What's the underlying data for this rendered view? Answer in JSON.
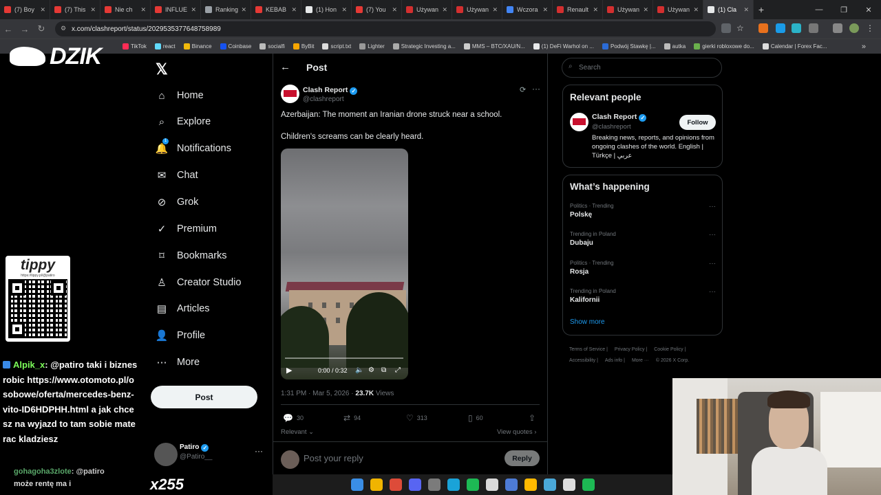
{
  "browser": {
    "tabs": [
      {
        "title": "(7) Boy",
        "color": "#e53935"
      },
      {
        "title": "(7) This",
        "color": "#e53935"
      },
      {
        "title": "Nie ch",
        "color": "#e53935"
      },
      {
        "title": "INFLUE",
        "color": "#e53935"
      },
      {
        "title": "Ranking",
        "color": "#9aa0a6"
      },
      {
        "title": "KEBAB",
        "color": "#e53935"
      },
      {
        "title": "(1) Hon",
        "color": "#e7e9ea"
      },
      {
        "title": "(7) You",
        "color": "#e53935"
      },
      {
        "title": "Używan",
        "color": "#d32f2f"
      },
      {
        "title": "Używan",
        "color": "#d32f2f"
      },
      {
        "title": "Wczora",
        "color": "#4285f4"
      },
      {
        "title": "Renault",
        "color": "#d32f2f"
      },
      {
        "title": "Używan",
        "color": "#d32f2f"
      },
      {
        "title": "Używan",
        "color": "#d32f2f"
      },
      {
        "title": "(1) Cla",
        "color": "#e7e9ea",
        "active": true
      }
    ],
    "url": "x.com/clashreport/status/2029535377648758989",
    "bookmarks": [
      "TikTok",
      "react",
      "Binance",
      "Coinbase",
      "socialfi",
      "ByBit",
      "script.txt",
      "Lighter",
      "Strategic Investing a...",
      "MMS – BTC/XAU/N...",
      "(1) DeFi Warhol on ...",
      "Podwój Stawkę |...",
      "autka",
      "gierki robloxowe do...",
      "Calendar | Forex Fac..."
    ]
  },
  "overlay": {
    "logo": "DZIK",
    "tippy_logo": "tippy",
    "tippy_url": "https://tippy.pl/@patiro",
    "chat": [
      {
        "nick": "Alpik_x",
        "text": ": @patiro taki i biznes robic https://www.otomoto.pl/osobowe/oferta/mercedes-benz-vito-ID6HDPHH.html a jak chcesz na wyjazd to tam sobie materac kladziesz"
      }
    ],
    "chat_next": {
      "nick": "gohagoha3zlote",
      "text": ": @patiro"
    },
    "chat_next2": "może rentę ma i",
    "counter": "x255"
  },
  "x_nav": {
    "items": [
      {
        "label": "Home",
        "icon": "home-icon"
      },
      {
        "label": "Explore",
        "icon": "search-icon"
      },
      {
        "label": "Notifications",
        "icon": "bell-icon",
        "badge": "1"
      },
      {
        "label": "Chat",
        "icon": "mail-icon"
      },
      {
        "label": "Grok",
        "icon": "grok-icon"
      },
      {
        "label": "Premium",
        "icon": "premium-icon"
      },
      {
        "label": "Bookmarks",
        "icon": "bookmark-icon"
      },
      {
        "label": "Creator Studio",
        "icon": "creator-studio-icon"
      },
      {
        "label": "Articles",
        "icon": "articles-icon"
      },
      {
        "label": "Profile",
        "icon": "profile-icon"
      },
      {
        "label": "More",
        "icon": "more-icon"
      }
    ],
    "post_button": "Post",
    "account": {
      "name": "Patiro",
      "handle": "@Patiro__"
    }
  },
  "post": {
    "header": "Post",
    "author": {
      "name": "Clash Report",
      "handle": "@clashreport"
    },
    "text1": "Azerbaijan: The moment an Iranian drone struck near a school.",
    "text2": "Children's screams can be clearly heard.",
    "video": {
      "time": "0:00 / 0:32",
      "progress": 0.0
    },
    "meta": {
      "time": "1:31 PM · Mar 5, 2026 · ",
      "views": "23.7K",
      "views_label": " Views"
    },
    "stats": {
      "replies": "30",
      "reposts": "94",
      "likes": "313",
      "bookmarks": "60"
    },
    "relevant": "Relevant ⌄",
    "view_quotes": "View quotes ›",
    "reply_placeholder": "Post your reply",
    "reply_button": "Reply"
  },
  "right": {
    "search_placeholder": "Search",
    "relevant_people": {
      "title": "Relevant people",
      "name": "Clash Report",
      "handle": "@clashreport",
      "follow": "Follow",
      "bio": "Breaking news, reports, and opinions from ongoing clashes of the world. English | Türkçe | عربي"
    },
    "whats_happening": {
      "title": "What’s happening",
      "trends": [
        {
          "context": "Politics · Trending",
          "name": "Polskę"
        },
        {
          "context": "Trending in Poland",
          "name": "Dubaju"
        },
        {
          "context": "Politics · Trending",
          "name": "Rosja"
        },
        {
          "context": "Trending in Poland",
          "name": "Kalifornii"
        }
      ],
      "show_more": "Show more"
    },
    "footer": [
      "Terms of Service |",
      "Privacy Policy |",
      "Cookie Policy |",
      "Accessibility |",
      "Ads info |",
      "More ···",
      "© 2026 X Corp."
    ]
  },
  "colors": {
    "accent": "#1d9bf0",
    "background": "#000000",
    "text": "#e7e9ea",
    "muted": "#71767b"
  }
}
